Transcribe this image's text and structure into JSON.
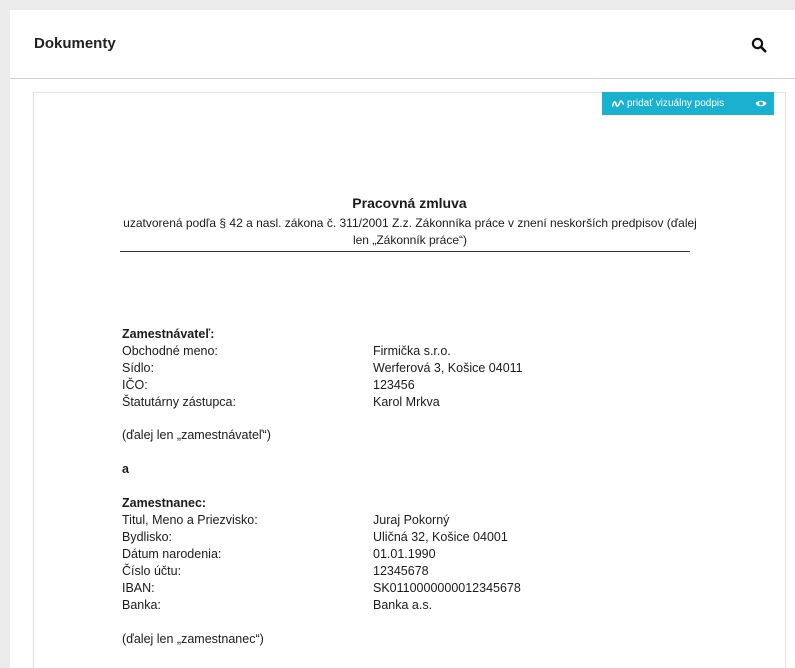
{
  "header": {
    "title": "Dokumenty",
    "search_icon": "search-icon"
  },
  "toolbar": {
    "sign_label": "pridať vizuálny podpis",
    "sign_icon": "signature-icon",
    "preview_icon": "eye-icon",
    "accent": "#19b1cf"
  },
  "document": {
    "title": "Pracovná zmluva",
    "subtitle": "uzatvorená podľa § 42 a nasl. zákona č. 311/2001 Z.z. Zákonníka práce v znení neskorších predpisov (ďalej len „Zákonník práce“)",
    "employer": {
      "heading": "Zamestnávateľ:",
      "rows": [
        {
          "label": "Obchodné meno:",
          "value": "Firmička s.r.o."
        },
        {
          "label": "Sídlo:",
          "value": "Werferová 3, Košice 04011"
        },
        {
          "label": "IČO:",
          "value": "123456"
        },
        {
          "label": "Štatutárny zástupca:",
          "value": "Karol Mrkva"
        }
      ],
      "note": "(ďalej len „zamestnávateľ“)"
    },
    "conjunction": "a",
    "employee": {
      "heading": "Zamestnanec:",
      "rows": [
        {
          "label": "Titul, Meno a Priezvisko:",
          "value": "Juraj Pokorný"
        },
        {
          "label": "Bydlisko:",
          "value": "Uličná 32, Košice 04001"
        },
        {
          "label": "Dátum narodenia:",
          "value": "01.01.1990"
        },
        {
          "label": "Číslo účtu:",
          "value": "12345678"
        },
        {
          "label": "IBAN:",
          "value": "SK0110000000012345678"
        },
        {
          "label": "Banka:",
          "value": "Banka a.s."
        }
      ],
      "note": "(ďalej len „zamestnanec“)"
    }
  }
}
